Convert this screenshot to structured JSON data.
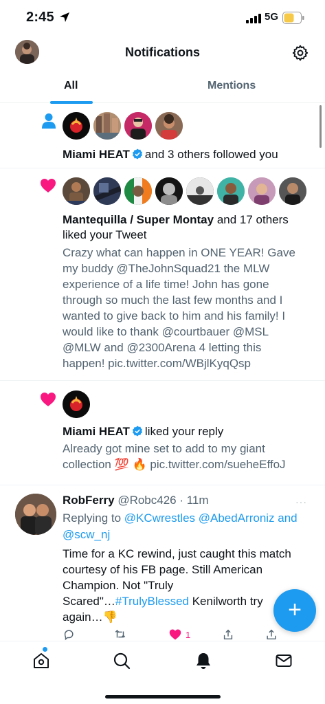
{
  "status_bar": {
    "time": "2:45",
    "network": "5G"
  },
  "header": {
    "title": "Notifications"
  },
  "tabs": [
    {
      "label": "All",
      "active": true
    },
    {
      "label": "Mentions",
      "active": false
    }
  ],
  "notifications": [
    {
      "type": "follow",
      "icon": "person-icon",
      "actor": "Miami HEAT",
      "verified": true,
      "text": "and 3 others followed you"
    },
    {
      "type": "like",
      "icon": "heart-icon",
      "actor": "Mantequilla / Super Montay",
      "text_line1": "and 17 others",
      "text_line2": "liked your Tweet",
      "body_lines": [
        "Crazy what can happen in ONE YEAR! Gave",
        "my buddy @TheJohnSquad21 the MLW",
        "experience of a life time! John has gone",
        "through so much the last few months and I",
        "wanted to give back to him and his family! I",
        "would like to thank @courtbauer @MSL",
        "@MLW and @2300Arena 4 letting this",
        "happen! pic.twitter.com/WBjlKyqQsp"
      ]
    },
    {
      "type": "like",
      "icon": "heart-icon",
      "actor": "Miami HEAT",
      "verified": true,
      "text": "liked your reply",
      "body_line1": "Already got mine set to add to my giant",
      "body_line2": "collection 💯 🔥 pic.twitter.com/sueheEffoJ"
    }
  ],
  "tweet": {
    "name": "RobFerry",
    "handle": "@Robc426",
    "time": "· 11m",
    "more": "···",
    "replying_prefix": "Replying to",
    "replying_users_line1": "@KCwrestles @AbedArroniz and",
    "replying_users_line2": "@scw_nj",
    "text_line1": "Time for a KC rewind, just caught this match",
    "text_line2": "courtesy of his FB page. Still American",
    "text_line3": "Champion. Not \"Truly",
    "text_line4_pre": "Scared\"…",
    "text_line4_link": "#TrulyBlessed",
    "text_line4_post": " Kenilworth try",
    "text_line5": "again…👎",
    "likes": "1"
  },
  "fab": {
    "label": "+"
  },
  "colors": {
    "accent": "#1d9bf0",
    "like": "#f91880",
    "text": "#0f1419",
    "muted": "#536471"
  }
}
